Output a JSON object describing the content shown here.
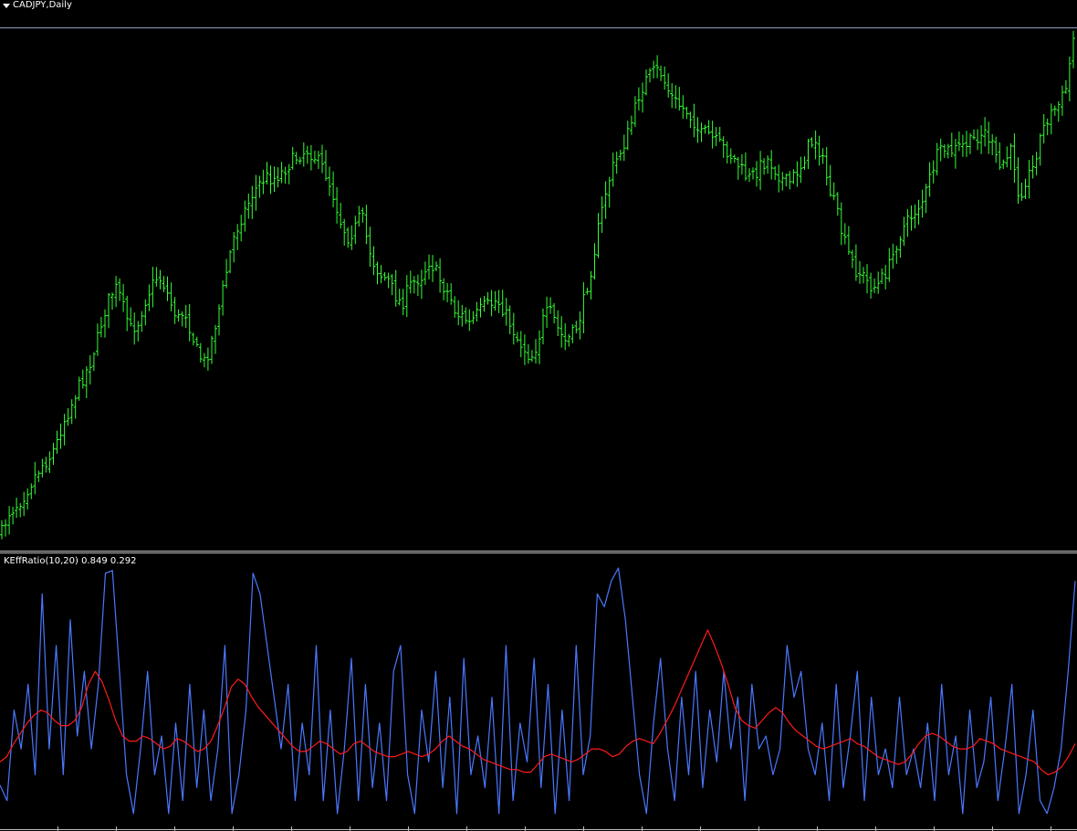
{
  "header": {
    "symbol": "CADJPY,Daily"
  },
  "indicator": {
    "name": "KEffRatio(10,20)",
    "value1": "0.849",
    "value2": "0.292"
  },
  "colors": {
    "background": "#000000",
    "candle": "#33ff33",
    "separator": "#c0c0c0",
    "ratio_line": "#4a78ff",
    "smoothed_line": "#ff1a1a"
  },
  "chart_data": [
    {
      "type": "line",
      "title": "CADJPY,Daily",
      "xlabel": "",
      "ylabel": "",
      "grid": false,
      "series": [
        {
          "values": [
            575,
            555,
            548,
            540,
            528,
            515,
            505,
            498,
            485,
            462,
            448,
            430,
            415,
            400,
            378,
            350,
            330,
            322,
            345,
            365,
            360,
            338,
            322,
            310,
            320,
            340,
            355,
            345,
            370,
            392,
            400,
            375,
            345,
            310,
            275,
            255,
            240,
            225,
            215,
            208,
            210,
            205,
            198,
            190,
            185,
            180,
            186,
            195,
            208,
            230,
            255,
            270,
            262,
            245,
            278,
            300,
            310,
            315,
            330,
            340,
            322,
            315,
            310,
            295,
            305,
            320,
            330,
            350,
            352,
            360,
            350,
            342,
            340,
            335,
            345,
            360,
            375,
            385,
            395,
            380,
            350,
            348,
            365,
            378,
            372,
            360,
            330,
            300,
            260,
            225,
            200,
            185,
            170,
            148,
            122,
            108,
            100,
            98,
            115,
            128,
            135,
            140,
            150,
            165,
            162,
            170,
            175,
            182,
            190,
            200,
            210,
            205,
            195,
            190,
            200,
            210,
            215,
            205,
            195,
            175,
            170,
            190,
            220,
            240,
            270,
            290,
            305,
            310,
            320,
            322,
            310,
            298,
            275,
            260,
            250,
            240,
            230,
            205,
            185,
            180,
            182,
            178,
            175,
            172,
            165,
            162,
            175,
            200,
            190,
            180,
            230,
            210,
            200,
            170,
            150,
            140,
            132,
            115,
            65
          ]
        }
      ]
    },
    {
      "type": "line",
      "title": "KEffRatio(10,20)",
      "xlabel": "",
      "ylabel": "",
      "grid": false,
      "series": [
        {
          "values": [
            0.16,
            0.1,
            0.45,
            0.3,
            0.55,
            0.2,
            0.9,
            0.3,
            0.7,
            0.2,
            0.8,
            0.35,
            0.6,
            0.3,
            0.55,
            0.98,
            0.99,
            0.6,
            0.2,
            0.05,
            0.3,
            0.6,
            0.2,
            0.35,
            0.05,
            0.4,
            0.1,
            0.55,
            0.15,
            0.45,
            0.1,
            0.3,
            0.7,
            0.05,
            0.2,
            0.45,
            0.98,
            0.9,
            0.7,
            0.5,
            0.3,
            0.55,
            0.1,
            0.4,
            0.2,
            0.7,
            0.1,
            0.45,
            0.05,
            0.3,
            0.65,
            0.1,
            0.55,
            0.15,
            0.4,
            0.1,
            0.6,
            0.7,
            0.2,
            0.05,
            0.45,
            0.25,
            0.6,
            0.15,
            0.5,
            0.05,
            0.65,
            0.2,
            0.35,
            0.15,
            0.5,
            0.05,
            0.7,
            0.1,
            0.4,
            0.25,
            0.65,
            0.15,
            0.55,
            0.05,
            0.45,
            0.1,
            0.7,
            0.2,
            0.35,
            0.9,
            0.85,
            0.95,
            1.0,
            0.8,
            0.5,
            0.2,
            0.05,
            0.4,
            0.65,
            0.3,
            0.1,
            0.5,
            0.2,
            0.6,
            0.15,
            0.45,
            0.25,
            0.6,
            0.3,
            0.5,
            0.1,
            0.55,
            0.3,
            0.35,
            0.2,
            0.3,
            0.7,
            0.5,
            0.6,
            0.3,
            0.2,
            0.4,
            0.1,
            0.55,
            0.15,
            0.35,
            0.6,
            0.1,
            0.5,
            0.2,
            0.3,
            0.15,
            0.5,
            0.2,
            0.3,
            0.15,
            0.4,
            0.1,
            0.55,
            0.2,
            0.35,
            0.05,
            0.45,
            0.15,
            0.25,
            0.5,
            0.1,
            0.3,
            0.55,
            0.05,
            0.2,
            0.45,
            0.1,
            0.05,
            0.15,
            0.3,
            0.6,
            0.95
          ]
        },
        {
          "values": [
            0.25,
            0.27,
            0.32,
            0.36,
            0.4,
            0.43,
            0.45,
            0.44,
            0.41,
            0.39,
            0.39,
            0.41,
            0.46,
            0.55,
            0.6,
            0.56,
            0.49,
            0.41,
            0.35,
            0.33,
            0.33,
            0.35,
            0.34,
            0.32,
            0.3,
            0.31,
            0.34,
            0.33,
            0.31,
            0.29,
            0.3,
            0.33,
            0.39,
            0.46,
            0.54,
            0.57,
            0.55,
            0.5,
            0.46,
            0.43,
            0.4,
            0.37,
            0.34,
            0.31,
            0.29,
            0.29,
            0.31,
            0.33,
            0.32,
            0.3,
            0.28,
            0.29,
            0.32,
            0.33,
            0.31,
            0.29,
            0.28,
            0.27,
            0.27,
            0.28,
            0.29,
            0.28,
            0.27,
            0.28,
            0.3,
            0.33,
            0.35,
            0.33,
            0.31,
            0.3,
            0.28,
            0.26,
            0.25,
            0.24,
            0.23,
            0.22,
            0.22,
            0.21,
            0.21,
            0.24,
            0.27,
            0.28,
            0.27,
            0.26,
            0.25,
            0.26,
            0.28,
            0.3,
            0.3,
            0.29,
            0.27,
            0.28,
            0.31,
            0.33,
            0.34,
            0.33,
            0.32,
            0.36,
            0.41,
            0.46,
            0.52,
            0.58,
            0.64,
            0.7,
            0.76,
            0.7,
            0.63,
            0.55,
            0.46,
            0.41,
            0.39,
            0.38,
            0.41,
            0.44,
            0.46,
            0.44,
            0.4,
            0.37,
            0.35,
            0.33,
            0.31,
            0.3,
            0.31,
            0.32,
            0.33,
            0.34,
            0.32,
            0.31,
            0.29,
            0.27,
            0.26,
            0.25,
            0.24,
            0.25,
            0.28,
            0.32,
            0.35,
            0.36,
            0.35,
            0.33,
            0.31,
            0.3,
            0.3,
            0.31,
            0.34,
            0.33,
            0.32,
            0.3,
            0.29,
            0.28,
            0.27,
            0.26,
            0.25,
            0.22,
            0.2,
            0.21,
            0.23,
            0.27,
            0.32
          ]
        }
      ]
    }
  ]
}
